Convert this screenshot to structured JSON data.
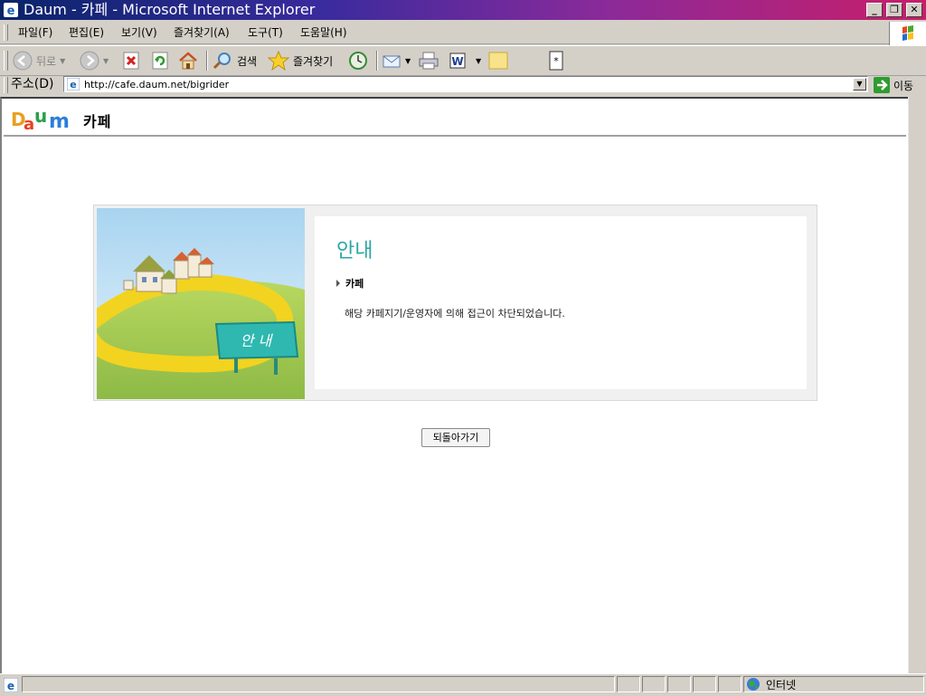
{
  "window": {
    "title": "Daum - 카페 - Microsoft Internet Explorer",
    "minimize": "_",
    "restore": "❐",
    "close": "✕"
  },
  "menu": [
    "파일(F)",
    "편집(E)",
    "보기(V)",
    "즐겨찾기(A)",
    "도구(T)",
    "도움말(H)"
  ],
  "toolbar": {
    "back_label": "뒤로",
    "search_label": "검색",
    "favorites_label": "즐겨찾기"
  },
  "address": {
    "label": "주소(D)",
    "url": "http://cafe.daum.net/bigrider",
    "go_label": "이동"
  },
  "page": {
    "logo_text": "Daum",
    "cafe_label": "카페",
    "image_sign": "안 내",
    "notice_title": "안내",
    "notice_subtitle": "카페",
    "notice_message": "해당 카페지기/운영자에 의해 접근이 차단되었습니다.",
    "back_button": "되돌아가기"
  },
  "status": {
    "zone_label": "인터넷"
  },
  "colors": {
    "accent": "#2ba6a6",
    "titlebar_start": "#0a246a",
    "titlebar_end": "#c81e6a"
  }
}
